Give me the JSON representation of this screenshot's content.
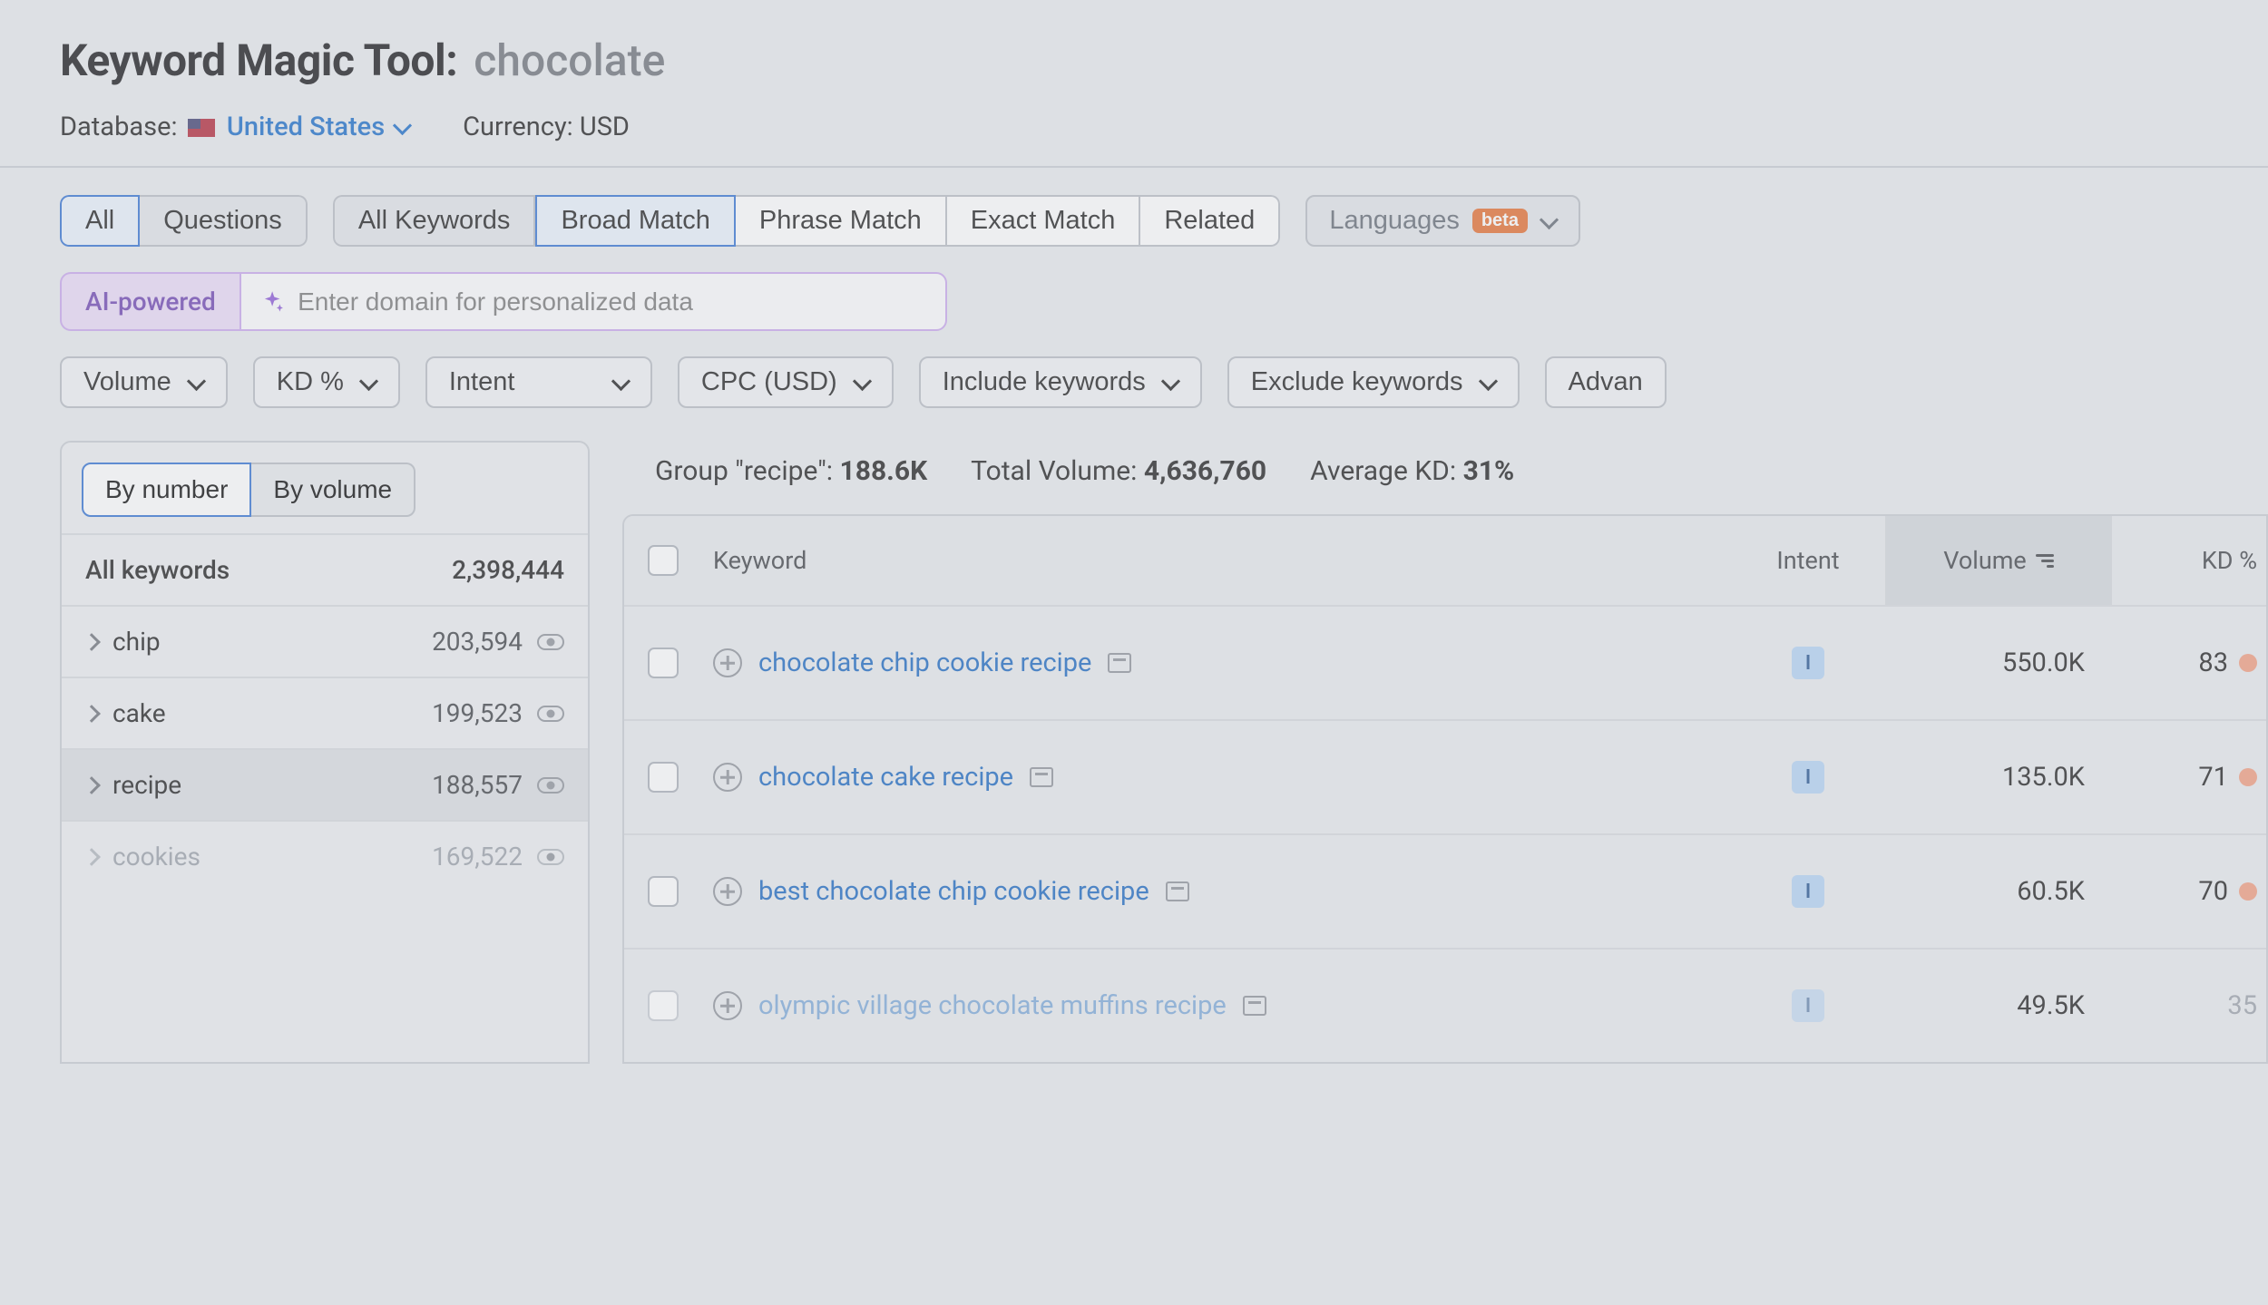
{
  "header": {
    "title": "Keyword Magic Tool:",
    "query": "chocolate",
    "db_label": "Database:",
    "country": "United States",
    "currency_label": "Currency: USD"
  },
  "scope_tabs": {
    "all": "All",
    "questions": "Questions"
  },
  "match_tabs": {
    "all_keywords": "All Keywords",
    "broad": "Broad Match",
    "phrase": "Phrase Match",
    "exact": "Exact Match",
    "related": "Related"
  },
  "languages": {
    "label": "Languages",
    "badge": "beta"
  },
  "ai": {
    "label": "AI-powered",
    "placeholder": "Enter domain for personalized data"
  },
  "filters": {
    "volume": "Volume",
    "kd": "KD %",
    "intent": "Intent",
    "cpc": "CPC (USD)",
    "include": "Include keywords",
    "exclude": "Exclude keywords",
    "advanced": "Advan"
  },
  "sidebar": {
    "sort_by_number": "By number",
    "sort_by_volume": "By volume",
    "all_label": "All keywords",
    "all_count": "2,398,444",
    "groups": [
      {
        "name": "chip",
        "count": "203,594",
        "selected": false,
        "faded": false
      },
      {
        "name": "cake",
        "count": "199,523",
        "selected": false,
        "faded": false
      },
      {
        "name": "recipe",
        "count": "188,557",
        "selected": true,
        "faded": false
      },
      {
        "name": "cookies",
        "count": "169,522",
        "selected": false,
        "faded": true
      }
    ]
  },
  "summary": {
    "group_label": "Group \"recipe\":",
    "group_value": "188.6K",
    "total_label": "Total Volume:",
    "total_value": "4,636,760",
    "kd_label": "Average KD:",
    "kd_value": "31%"
  },
  "table": {
    "head": {
      "keyword": "Keyword",
      "intent": "Intent",
      "volume": "Volume",
      "kd": "KD %"
    },
    "rows": [
      {
        "kw": "chocolate chip cookie recipe",
        "intent": "I",
        "volume": "550.0K",
        "kd": "83",
        "faded": false
      },
      {
        "kw": "chocolate cake recipe",
        "intent": "I",
        "volume": "135.0K",
        "kd": "71",
        "faded": false
      },
      {
        "kw": "best chocolate chip cookie recipe",
        "intent": "I",
        "volume": "60.5K",
        "kd": "70",
        "faded": false
      },
      {
        "kw": "olympic village chocolate muffins recipe",
        "intent": "I",
        "volume": "49.5K",
        "kd": "35",
        "faded": true
      }
    ]
  }
}
